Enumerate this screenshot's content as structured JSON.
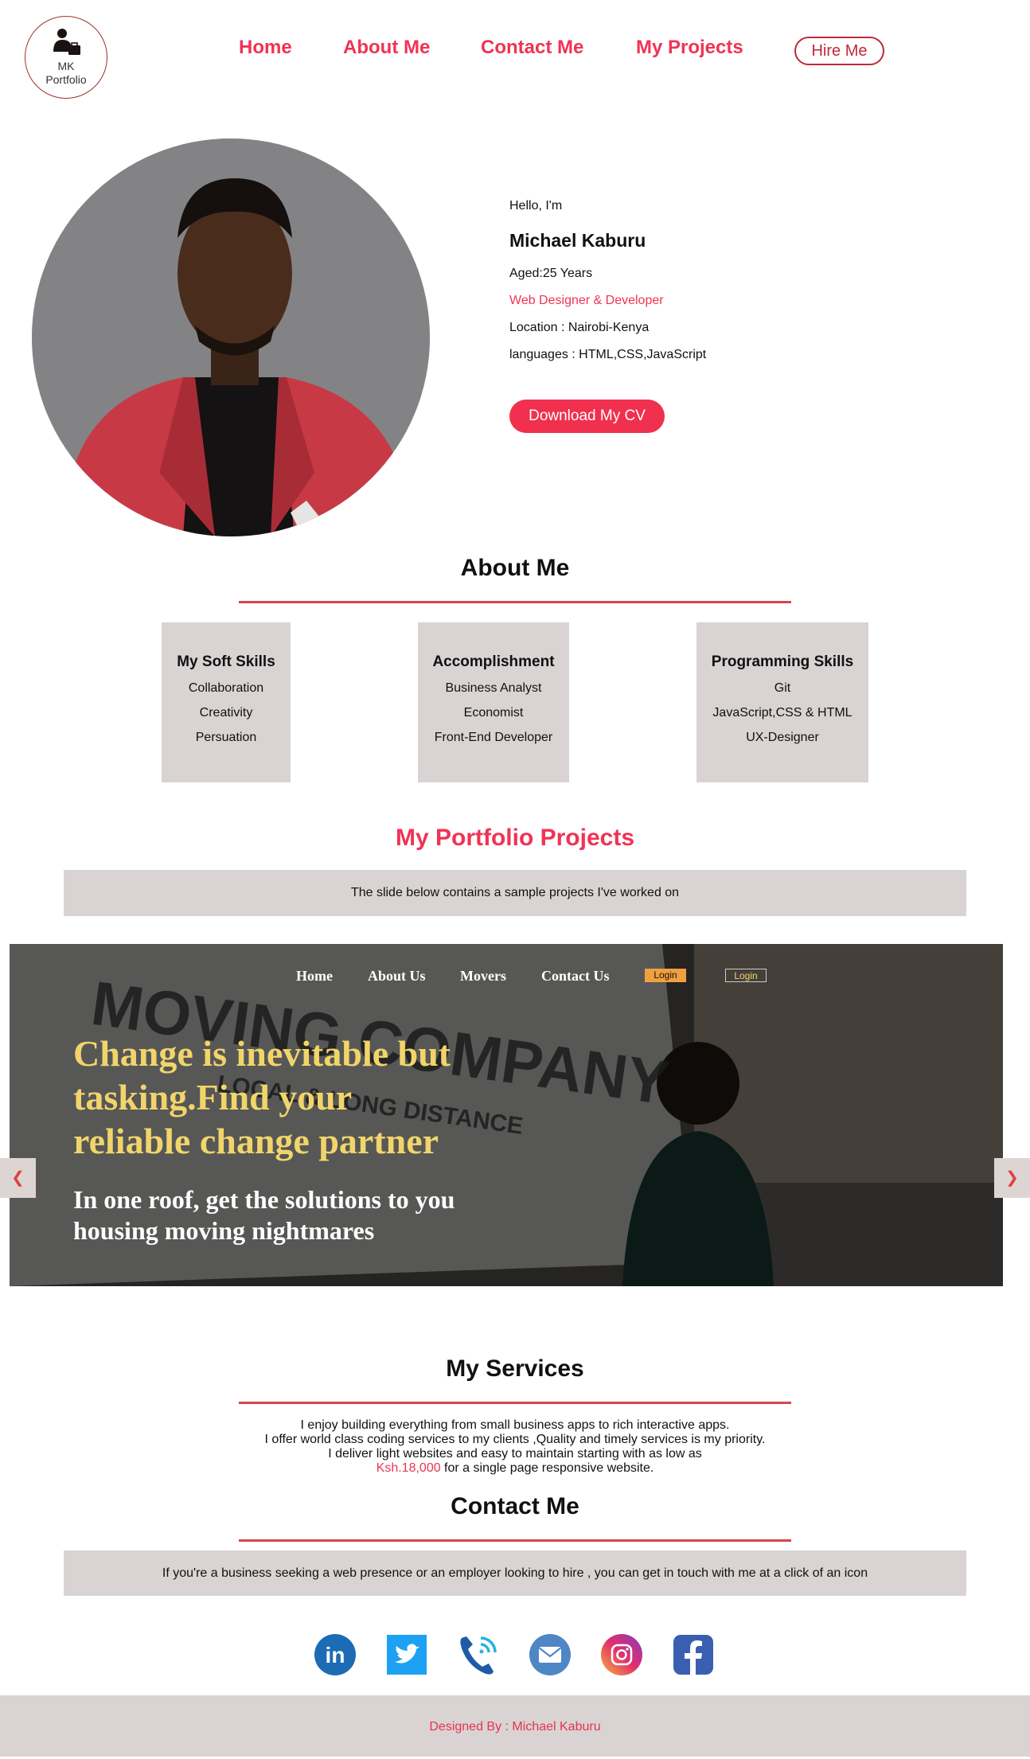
{
  "header": {
    "logo_text": [
      "MK",
      "Portfolio"
    ],
    "nav": [
      "Home",
      "About Me",
      "Contact Me",
      "My Projects"
    ],
    "hire_label": "Hire Me"
  },
  "hero": {
    "greeting": "Hello, I'm",
    "name": "Michael Kaburu",
    "age": "Aged:25 Years",
    "role": "Web Designer & Developer",
    "location": "Location : Nairobi-Kenya",
    "languages": "languages : HTML,CSS,JavaScript",
    "cv_button": "Download My CV"
  },
  "about": {
    "title": "About Me",
    "cards": [
      {
        "title": "My Soft Skills",
        "items": [
          "Collaboration",
          "Creativity",
          "Persuation"
        ]
      },
      {
        "title": "Accomplishment",
        "items": [
          "Business Analyst",
          "Economist",
          "Front-End Developer"
        ]
      },
      {
        "title": "Programming Skills",
        "items": [
          "Git",
          "JavaScript,CSS & HTML",
          "UX-Designer"
        ]
      }
    ]
  },
  "portfolio": {
    "title": "My Portfolio Projects",
    "note": "The slide below contains a sample projects I've worked on"
  },
  "slide": {
    "nav": [
      "Home",
      "About Us",
      "Movers",
      "Contact Us"
    ],
    "login1": "Login",
    "login2": "Login",
    "truck_text": [
      "MOVING COMPANY",
      "LOCAL & LONG DISTANCE"
    ],
    "headline": [
      "Change is inevitable but",
      "tasking.Find your",
      "reliable change partner"
    ],
    "subline": [
      "In one roof, get the solutions to you",
      "housing moving nightmares"
    ],
    "prev": "❮",
    "next": "❯"
  },
  "services": {
    "title": "My Services",
    "lines": [
      "I enjoy building everything from small business apps to rich interactive apps.",
      "I offer world class coding services to my clients ,Quality and timely services is my priority.",
      "I deliver light websites and easy to maintain starting with as low as"
    ],
    "price": "Ksh.18,000",
    "price_suffix": " for a single page responsive website."
  },
  "contact": {
    "title": "Contact Me",
    "note": "If you're a business seeking a web presence or an employer looking to hire , you can get in touch with me at a click of an icon",
    "icons": [
      "linkedin-icon",
      "twitter-icon",
      "phone-icon",
      "email-icon",
      "instagram-icon",
      "facebook-icon"
    ],
    "linkedin_text": "in"
  },
  "footer": {
    "text": "Designed By : Michael Kaburu"
  },
  "colors": {
    "accent": "#f03355",
    "panel": "#d9d3d3",
    "slide_headline": "#f2d56a"
  }
}
